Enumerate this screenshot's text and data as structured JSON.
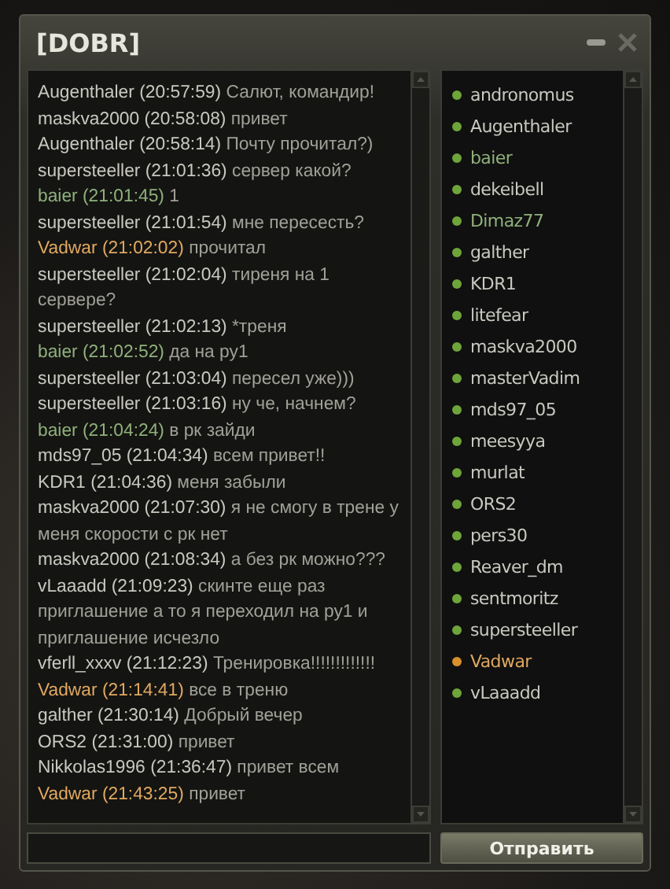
{
  "window": {
    "title": "[DOBR]"
  },
  "messages": [
    {
      "author": "Augenthaler",
      "time": "(20:57:59)",
      "text": "Салют, командир!",
      "kind": "other"
    },
    {
      "author": "maskva2000",
      "time": "(20:58:08)",
      "text": "привет",
      "kind": "other"
    },
    {
      "author": "Augenthaler",
      "time": "(20:58:14)",
      "text": "Почту прочитал?)",
      "kind": "other"
    },
    {
      "author": "supersteeller",
      "time": "(21:01:36)",
      "text": "сервер какой?",
      "kind": "other"
    },
    {
      "author": "baier",
      "time": "(21:01:45)",
      "text": "1",
      "kind": "friend"
    },
    {
      "author": "supersteeller",
      "time": "(21:01:54)",
      "text": "мне пересесть?",
      "kind": "other"
    },
    {
      "author": "Vadwar",
      "time": "(21:02:02)",
      "text": "прочитал",
      "kind": "self"
    },
    {
      "author": "supersteeller",
      "time": "(21:02:04)",
      "text": "тиреня на 1 сервере?",
      "kind": "other"
    },
    {
      "author": "supersteeller",
      "time": "(21:02:13)",
      "text": "*треня",
      "kind": "other"
    },
    {
      "author": "baier",
      "time": "(21:02:52)",
      "text": "да на ру1",
      "kind": "friend"
    },
    {
      "author": "supersteeller",
      "time": "(21:03:04)",
      "text": "пересел уже)))",
      "kind": "other"
    },
    {
      "author": "supersteeller",
      "time": "(21:03:16)",
      "text": "ну че, начнем?",
      "kind": "other"
    },
    {
      "author": "baier",
      "time": "(21:04:24)",
      "text": "в рк зайди",
      "kind": "friend"
    },
    {
      "author": "mds97_05",
      "time": "(21:04:34)",
      "text": "всем привет!!",
      "kind": "other"
    },
    {
      "author": "KDR1",
      "time": "(21:04:36)",
      "text": "меня забыли",
      "kind": "other"
    },
    {
      "author": "maskva2000",
      "time": "(21:07:30)",
      "text": "я не смогу в трене у меня скорости с рк нет",
      "kind": "other"
    },
    {
      "author": "maskva2000",
      "time": "(21:08:34)",
      "text": "а без рк можно???",
      "kind": "other"
    },
    {
      "author": "vLaaadd",
      "time": "(21:09:23)",
      "text": "скинте еще раз приглашение а то я переходил на ру1 и приглашение исчезло",
      "kind": "other"
    },
    {
      "author": "vferll_xxxv",
      "time": "(21:12:23)",
      "text": "Тренировка!!!!!!!!!!!!!",
      "kind": "other"
    },
    {
      "author": "Vadwar",
      "time": "(21:14:41)",
      "text": "все в треню",
      "kind": "self"
    },
    {
      "author": "galther",
      "time": "(21:30:14)",
      "text": "Добрый вечер",
      "kind": "other"
    },
    {
      "author": "ORS2",
      "time": "(21:31:00)",
      "text": "привет",
      "kind": "other"
    },
    {
      "author": "Nikkolas1996",
      "time": "(21:36:47)",
      "text": "привет всем",
      "kind": "other"
    },
    {
      "author": "Vadwar",
      "time": "(21:43:25)",
      "text": "привет",
      "kind": "self"
    }
  ],
  "members": [
    {
      "name": "andronomus",
      "kind": "other"
    },
    {
      "name": "Augenthaler",
      "kind": "other"
    },
    {
      "name": "baier",
      "kind": "friend"
    },
    {
      "name": "dekeibell",
      "kind": "other"
    },
    {
      "name": "Dimaz77",
      "kind": "friend"
    },
    {
      "name": "galther",
      "kind": "other"
    },
    {
      "name": "KDR1",
      "kind": "other"
    },
    {
      "name": "litefear",
      "kind": "other"
    },
    {
      "name": "maskva2000",
      "kind": "other"
    },
    {
      "name": "masterVadim",
      "kind": "other"
    },
    {
      "name": "mds97_05",
      "kind": "other"
    },
    {
      "name": "meesyya",
      "kind": "other"
    },
    {
      "name": "murlat",
      "kind": "other"
    },
    {
      "name": "ORS2",
      "kind": "other"
    },
    {
      "name": "pers30",
      "kind": "other"
    },
    {
      "name": "Reaver_dm",
      "kind": "other"
    },
    {
      "name": "sentmoritz",
      "kind": "other"
    },
    {
      "name": "supersteeller",
      "kind": "other"
    },
    {
      "name": "Vadwar",
      "kind": "self"
    },
    {
      "name": "vLaaadd",
      "kind": "other"
    }
  ],
  "send_button": "Отправить"
}
